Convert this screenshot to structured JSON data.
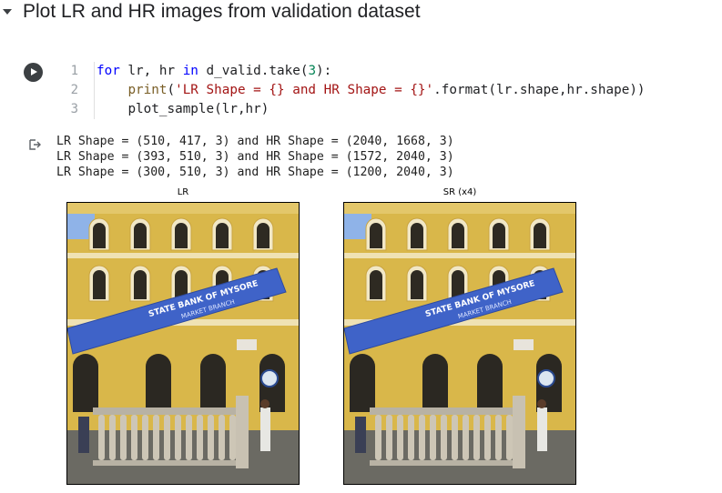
{
  "section": {
    "title": "Plot LR and HR images from validation dataset"
  },
  "cell": {
    "line_numbers": [
      "1",
      "2",
      "3"
    ],
    "code": {
      "line1": {
        "kw1": "for",
        "t1": " lr, hr ",
        "kw2": "in",
        "t2": " d_valid.take(",
        "num": "3",
        "t3": "):"
      },
      "line2": {
        "indent": "    ",
        "fn": "print",
        "t1": "(",
        "str": "'LR Shape = {} and HR Shape = {}'",
        "t2": ".format(lr.shape,hr.shape))"
      },
      "line3": {
        "indent": "    ",
        "t1": "plot_sample(lr,hr)"
      }
    }
  },
  "output": {
    "lines": [
      "LR Shape = (510, 417, 3) and HR Shape = (2040, 1668, 3)",
      "LR Shape = (393, 510, 3) and HR Shape = (1572, 2040, 3)",
      "LR Shape = (300, 510, 3) and HR Shape = (1200, 2040, 3)"
    ]
  },
  "plots": {
    "lr": {
      "title": "LR",
      "banner_text": "STATE BANK OF MYSORE",
      "banner_sub": "MARKET BRANCH"
    },
    "sr": {
      "title": "SR (x4)",
      "banner_text": "STATE BANK OF MYSORE",
      "banner_sub": "MARKET BRANCH"
    }
  },
  "colors": {
    "wall": "#d9b74a",
    "banner": "#3f63c8",
    "sky": "#8fb3e8",
    "railing": "#b8b2a4"
  }
}
